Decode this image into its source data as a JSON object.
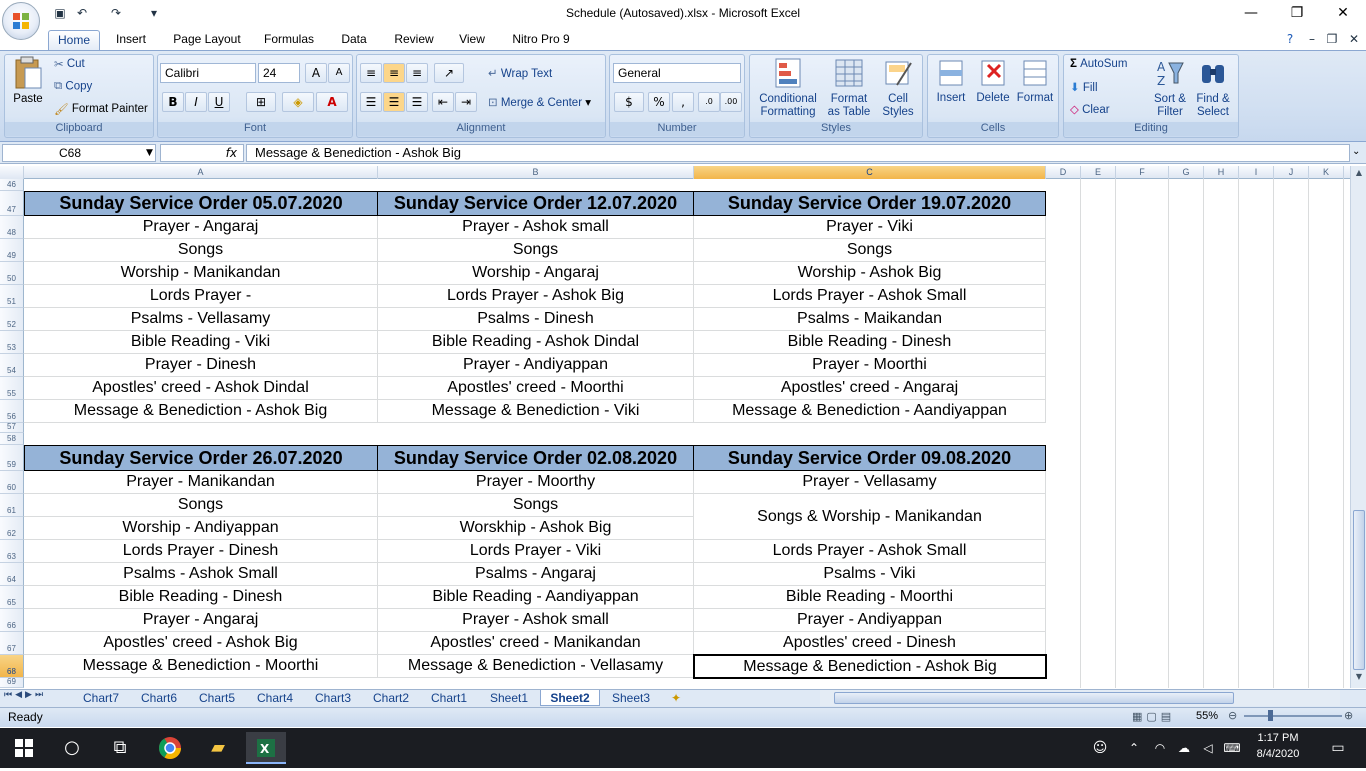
{
  "window": {
    "title": "Schedule (Autosaved).xlsx - Microsoft Excel"
  },
  "ribbon_tabs": [
    "Home",
    "Insert",
    "Page Layout",
    "Formulas",
    "Data",
    "Review",
    "View",
    "Nitro Pro 9"
  ],
  "clipboard": {
    "paste": "Paste",
    "cut": "Cut",
    "copy": "Copy",
    "format_painter": "Format Painter",
    "label": "Clipboard"
  },
  "font": {
    "name": "Calibri",
    "size": "24",
    "label": "Font",
    "bold": "B",
    "italic": "I",
    "underline": "U"
  },
  "alignment": {
    "wrap_text": "Wrap Text",
    "merge_center": "Merge & Center",
    "label": "Alignment"
  },
  "number": {
    "format": "General",
    "label": "Number",
    "currency": "$",
    "percent": "%",
    "comma": ","
  },
  "styles": {
    "conditional": "Conditional",
    "formatting": "Formatting",
    "format": "Format",
    "as_table": "as Table",
    "cell": "Cell",
    "cell_styles": "Styles",
    "label": "Styles"
  },
  "cells": {
    "insert": "Insert",
    "delete": "Delete",
    "format": "Format",
    "label": "Cells"
  },
  "editing": {
    "autosum": "AutoSum",
    "fill": "Fill",
    "clear": "Clear",
    "sort": "Sort &",
    "filter": "Filter",
    "find": "Find &",
    "select": "Select",
    "label": "Editing"
  },
  "formula_bar": {
    "name_box": "C68",
    "fx": "fx",
    "content": "Message & Benediction - Ashok Big"
  },
  "columns": [
    "A",
    "B",
    "C",
    "D",
    "E",
    "F",
    "G",
    "H",
    "I",
    "J",
    "K"
  ],
  "rows": [
    "46",
    "47",
    "48",
    "49",
    "50",
    "51",
    "52",
    "53",
    "54",
    "55",
    "56",
    "57",
    "58",
    "59",
    "60",
    "61",
    "62",
    "63",
    "64",
    "65",
    "66",
    "67",
    "68",
    "69"
  ],
  "block1": {
    "headers": [
      "Sunday Service Order 05.07.2020",
      "Sunday Service Order 12.07.2020",
      "Sunday Service Order 19.07.2020"
    ],
    "colA": [
      "Prayer - Angaraj",
      "Songs",
      "Worship - Manikandan",
      "Lords Prayer -",
      "Psalms - Vellasamy",
      "Bible Reading - Viki",
      "Prayer - Dinesh",
      "Apostles' creed - Ashok Dindal",
      "Message & Benediction - Ashok Big"
    ],
    "colB": [
      "Prayer - Ashok small",
      "Songs",
      "Worship - Angaraj",
      "Lords Prayer -  Ashok Big",
      "Psalms - Dinesh",
      "Bible Reading -   Ashok Dindal",
      "Prayer - Andiyappan",
      "Apostles' creed - Moorthi",
      "Message & Benediction - Viki"
    ],
    "colC": [
      "Prayer - Viki",
      "Songs",
      "Worship - Ashok Big",
      "Lords Prayer -  Ashok Small",
      "Psalms - Maikandan",
      "Bible Reading -   Dinesh",
      "Prayer - Moorthi",
      "Apostles' creed - Angaraj",
      "Message & Benediction - Aandiyappan"
    ]
  },
  "block2": {
    "headers": [
      "Sunday Service Order 26.07.2020",
      "Sunday Service Order 02.08.2020",
      "Sunday Service Order 09.08.2020"
    ],
    "colA": [
      "Prayer - Manikandan",
      "Songs",
      "Worship - Andiyappan",
      "Lords Prayer -  Dinesh",
      "Psalms - Ashok Small",
      "Bible Reading -   Dinesh",
      "Prayer - Angaraj",
      "Apostles' creed - Ashok Big",
      "Message & Benediction - Moorthi"
    ],
    "colB": [
      "Prayer - Moorthy",
      "Songs",
      "Worskhip - Ashok Big",
      "Lords Prayer - Viki",
      "Psalms - Angaraj",
      "Bible Reading - Aandiyappan",
      "Prayer - Ashok small",
      "Apostles' creed - Manikandan",
      "Message & Benediction - Vellasamy"
    ],
    "colC": [
      "Prayer - Vellasamy",
      "Songs & Worship - Manikandan",
      "Lords Prayer - Ashok Small",
      "Psalms - Viki",
      "Bible Reading - Moorthi",
      "Prayer - Andiyappan",
      "Apostles' creed - Dinesh",
      "Message & Benediction - Ashok Big"
    ]
  },
  "sheet_tabs": [
    "Chart7",
    "Chart6",
    "Chart5",
    "Chart4",
    "Chart3",
    "Chart2",
    "Chart1",
    "Sheet1",
    "Sheet2",
    "Sheet3"
  ],
  "active_sheet": "Sheet2",
  "status": {
    "ready": "Ready",
    "zoom": "55%"
  },
  "taskbar": {
    "time": "1:17 PM",
    "date": "8/4/2020"
  },
  "colors": {
    "header_fill": "#95b3d7",
    "selected_header": "#f2b54a"
  }
}
